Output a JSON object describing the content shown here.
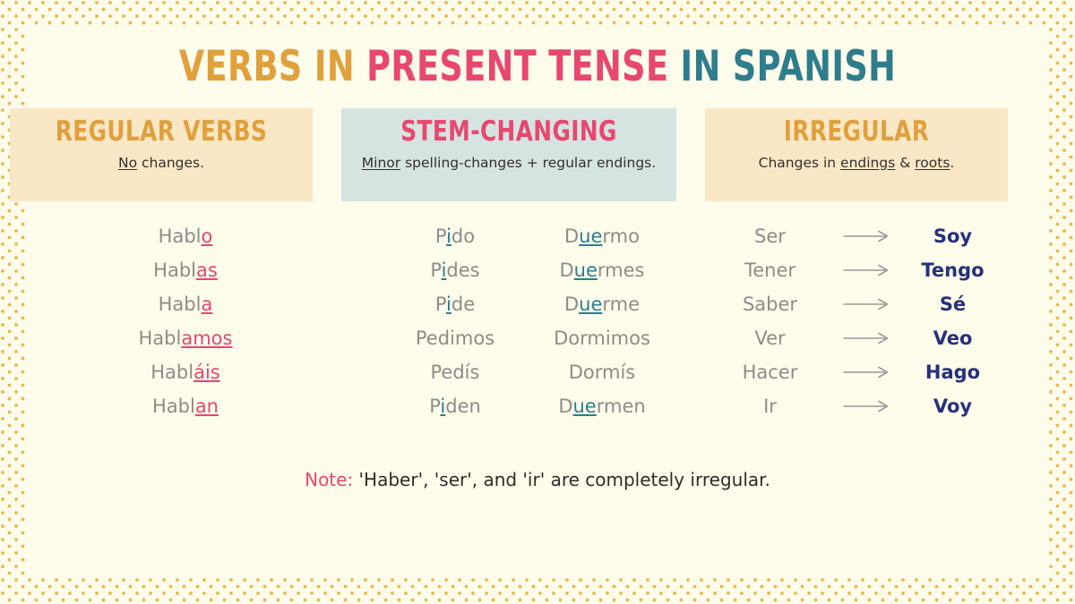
{
  "title": {
    "segments": [
      {
        "text": "VERBS IN ",
        "color": "#E0A03C"
      },
      {
        "text": "PRESENT TENSE ",
        "color": "#E8476F"
      },
      {
        "text": "IN SPANISH",
        "color": "#2E7D8C"
      }
    ],
    "part1": "VERBS IN ",
    "part2": "PRESENT TENSE ",
    "part3": "IN SPANISH"
  },
  "categories": {
    "regular": {
      "heading": "REGULAR VERBS",
      "sub_underlined": "No",
      "sub_rest": " changes.",
      "heading_color": "#E0A03C",
      "box_color": "#FAE7C6"
    },
    "stem": {
      "heading": "STEM-CHANGING",
      "sub_underlined": "Minor",
      "sub_rest": " spelling-changes + regular endings.",
      "heading_color": "#E8476F",
      "box_color": "#D6E4E1"
    },
    "irregular": {
      "heading": "IRREGULAR",
      "sub_pre": "Changes in ",
      "sub_u1": "endings",
      "sub_mid": " & ",
      "sub_u2": "roots",
      "sub_post": ".",
      "heading_color": "#E0A03C",
      "box_color": "#FAE7C6"
    }
  },
  "columns": {
    "hablar": {
      "rows": [
        {
          "stem": "Habl",
          "ending": "o"
        },
        {
          "stem": "Habl",
          "ending": "as"
        },
        {
          "stem": "Habl",
          "ending": "a"
        },
        {
          "stem": "Habl",
          "ending": "amos"
        },
        {
          "stem": "Habl",
          "ending": "áis"
        },
        {
          "stem": "Habl",
          "ending": "an"
        }
      ]
    },
    "pedir": {
      "rows": [
        {
          "pre": "P",
          "change": "i",
          "post": "do"
        },
        {
          "pre": "P",
          "change": "i",
          "post": "des"
        },
        {
          "pre": "P",
          "change": "i",
          "post": "de"
        },
        {
          "pre": "Pedimos",
          "change": "",
          "post": ""
        },
        {
          "pre": "Pedís",
          "change": "",
          "post": ""
        },
        {
          "pre": "P",
          "change": "i",
          "post": "den"
        }
      ]
    },
    "dormir": {
      "rows": [
        {
          "pre": "D",
          "change": "ue",
          "post": "rmo"
        },
        {
          "pre": "D",
          "change": "ue",
          "post": "rmes"
        },
        {
          "pre": "D",
          "change": "ue",
          "post": "rme"
        },
        {
          "pre": "Dormimos",
          "change": "",
          "post": ""
        },
        {
          "pre": "Dormís",
          "change": "",
          "post": ""
        },
        {
          "pre": "D",
          "change": "ue",
          "post": "rmen"
        }
      ]
    },
    "irregular": {
      "rows": [
        {
          "infinitive": "Ser",
          "conjugated": "Soy"
        },
        {
          "infinitive": "Tener",
          "conjugated": "Tengo"
        },
        {
          "infinitive": "Saber",
          "conjugated": "Sé"
        },
        {
          "infinitive": "Ver",
          "conjugated": "Veo"
        },
        {
          "infinitive": "Hacer",
          "conjugated": "Hago"
        },
        {
          "infinitive": "Ir",
          "conjugated": "Voy"
        }
      ]
    }
  },
  "note": {
    "label": "Note:",
    "text": " 'Haber', 'ser', and 'ir' are completely irregular."
  },
  "colors": {
    "background": "#FDFBE9",
    "panel": "#FEFCEB",
    "dot": "#E8B84B",
    "gold": "#E0A03C",
    "pink": "#E8476F",
    "teal": "#2E7D8C",
    "stem_accent": "#2A7F8E",
    "grey_text": "#8D8C88",
    "navy": "#26317A"
  }
}
